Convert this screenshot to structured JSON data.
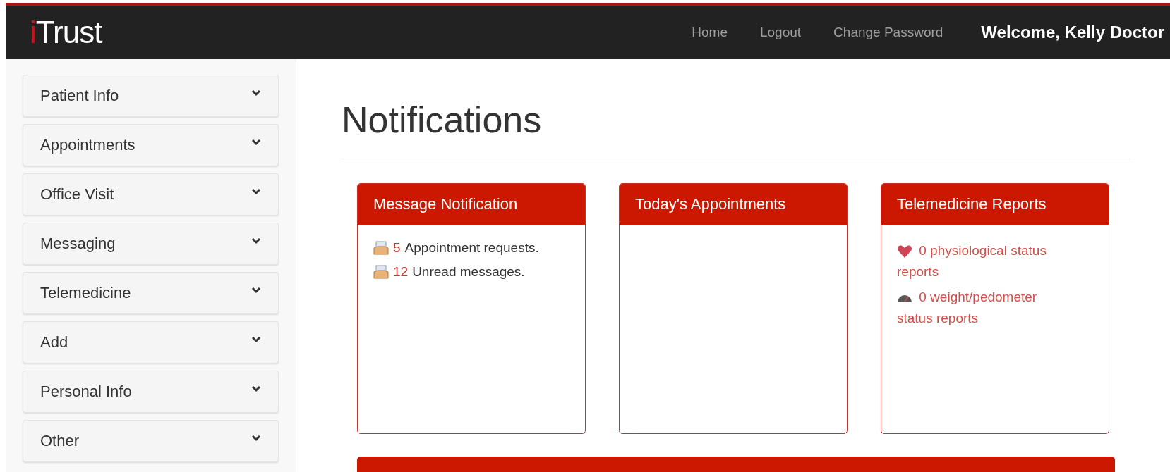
{
  "navbar": {
    "logo": {
      "accent": "i",
      "rest": "Trust"
    },
    "links": [
      "Home",
      "Logout",
      "Change Password"
    ],
    "welcome": "Welcome, Kelly Doctor"
  },
  "sidebar": {
    "items": [
      {
        "label": "Patient Info",
        "expanded": false
      },
      {
        "label": "Appointments",
        "expanded": false
      },
      {
        "label": "Office Visit",
        "expanded": false
      },
      {
        "label": "Messaging",
        "expanded": false
      },
      {
        "label": "Telemedicine",
        "expanded": false
      },
      {
        "label": "Add",
        "expanded": false
      },
      {
        "label": "Personal Info",
        "expanded": false
      },
      {
        "label": "Other",
        "expanded": false
      }
    ]
  },
  "heading": "Notifications",
  "panels": [
    {
      "title": "Message Notification",
      "kind": "messages",
      "rows": [
        {
          "count": "5",
          "text": "Appointment requests."
        },
        {
          "count": "12",
          "text": "Unread messages."
        }
      ]
    },
    {
      "title": "Today's Appointments",
      "kind": "empty"
    },
    {
      "title": "Telemedicine Reports",
      "kind": "reports",
      "rows": [
        {
          "kind": "heart",
          "text": "0 physiological status reports"
        },
        {
          "kind": "gauge",
          "text": "0 weight/pedometer status reports"
        }
      ]
    }
  ]
}
